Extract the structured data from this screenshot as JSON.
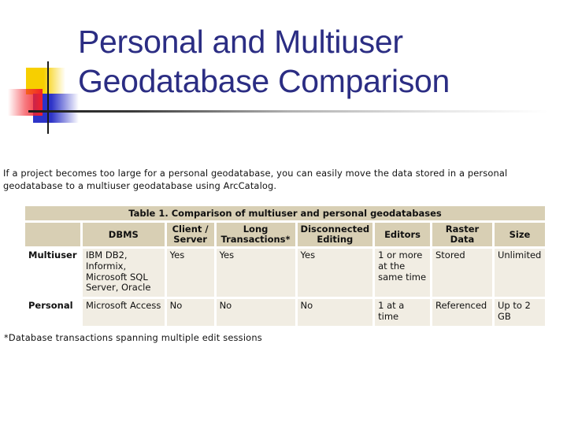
{
  "slide": {
    "title_line1": "Personal and Multiuser",
    "title_line2": "Geodatabase Comparison",
    "intro_text": "If a project becomes too large for a personal geodatabase, you can easily move the data stored in a personal geodatabase to a multiuser geodatabase using ArcCatalog.",
    "footnote": "*Database transactions spanning multiple edit sessions",
    "colors": {
      "title": "#2b2d83",
      "header_bg": "#d8cfb4",
      "cell_bg": "#f1ede3"
    }
  },
  "table": {
    "caption": "Table 1. Comparison of multiuser and personal geodatabases",
    "headers": [
      "",
      "DBMS",
      "Client / Server",
      "Long Transactions*",
      "Disconnected Editing",
      "Editors",
      "Raster Data",
      "Size"
    ],
    "rows": [
      {
        "type": "Multiuser",
        "dbms": "IBM DB2, Informix, Microsoft SQL Server, Oracle",
        "client_server": "Yes",
        "long_transactions": "Yes",
        "disconnected_editing": "Yes",
        "editors": "1 or more at the same time",
        "raster_data": "Stored",
        "size": "Unlimited"
      },
      {
        "type": "Personal",
        "dbms": "Microsoft Access",
        "client_server": "No",
        "long_transactions": "No",
        "disconnected_editing": "No",
        "editors": "1 at a time",
        "raster_data": "Referenced",
        "size": "Up to 2 GB"
      }
    ]
  }
}
